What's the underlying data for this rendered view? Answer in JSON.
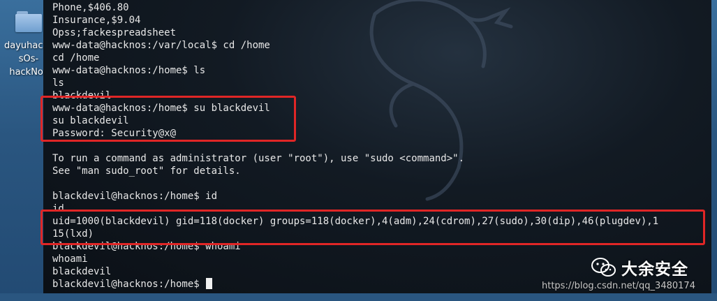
{
  "desktop": {
    "icon": {
      "name": "folder-icon",
      "label": "dayuhackn\nsOs-\nhackNos"
    }
  },
  "terminal": {
    "lines": [
      "Phone,$406.80",
      "Insurance,$9.04",
      "Opss;fackespreadsheet",
      "www-data@hacknos:/var/local$ cd /home",
      "cd /home",
      "www-data@hacknos:/home$ ls",
      "ls",
      "blackdevil",
      "www-data@hacknos:/home$ su blackdevil",
      "su blackdevil",
      "Password: Security@x@",
      "",
      "To run a command as administrator (user \"root\"), use \"sudo <command>\".",
      "See \"man sudo_root\" for details.",
      "",
      "blackdevil@hacknos:/home$ id",
      "id",
      "uid=1000(blackdevil) gid=118(docker) groups=118(docker),4(adm),24(cdrom),27(sudo),30(dip),46(plugdev),1",
      "15(lxd)",
      "blackdevil@hacknos:/home$ whoami",
      "whoami",
      "blackdevil"
    ],
    "prompt": "blackdevil@hacknos:/home$ ",
    "watermark_icon": "kali-dragon-icon"
  },
  "overlay": {
    "brand": "大余安全",
    "brand_icon": "wechat-icon",
    "url": "https://blog.csdn.net/qq_3480174"
  },
  "colors": {
    "highlight": "#e02626",
    "terminal_text": "#e8e8e8",
    "desktop_bg": "#2f5e88"
  }
}
